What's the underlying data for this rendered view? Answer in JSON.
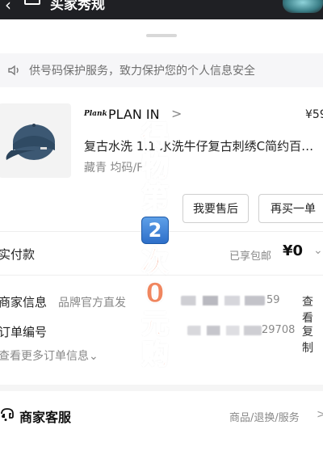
{
  "header": {
    "title": "买家秀规"
  },
  "notice": {
    "text": "供号码保护服务，致力保护您的个人信息安全",
    "icon": "speaker-icon"
  },
  "product": {
    "brand_logo": "Plank",
    "brand_name": "PLAN IN",
    "brand_chevron": ">",
    "price": "¥59",
    "title": "复古水洗 1:1 水洗牛仔复古刺绣C简约百…",
    "spec": "藏青 均码/F"
  },
  "actions": {
    "after_sale": "我要售后",
    "buy_again": "再买一单"
  },
  "payment": {
    "label": "实付款",
    "discount_note": "已享包邮",
    "amount": "¥0",
    "chevron": "⌄"
  },
  "merchant": {
    "label": "商家信息",
    "type": "品牌官方直发",
    "masked_tail": "59",
    "link": "查看"
  },
  "order": {
    "label": "订单编号",
    "masked_tail": "29708",
    "link": "复制"
  },
  "more_info": "查看更多订单信息⌄",
  "service": {
    "title": "商家客服",
    "links": "商品/退换/服务",
    "chevron": ">"
  },
  "overlay": {
    "chars_top": [
      "得",
      "物",
      "第"
    ],
    "number": "2",
    "chars_bottom": [
      "次",
      "0",
      "元",
      "购"
    ]
  }
}
